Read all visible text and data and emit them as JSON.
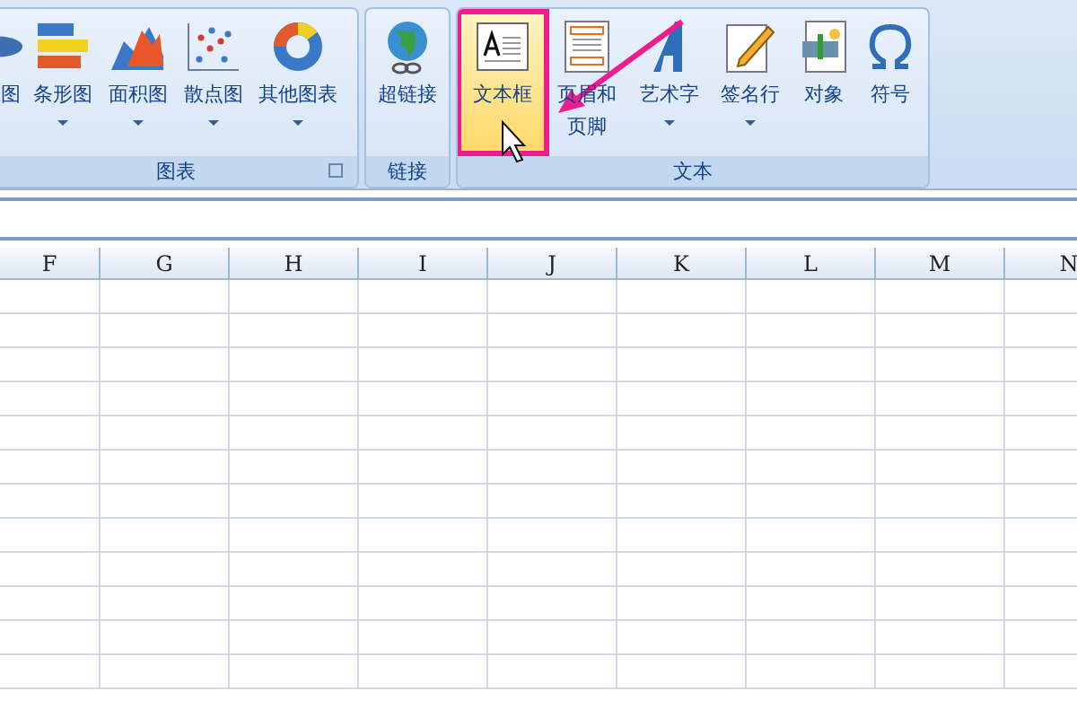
{
  "ribbon": {
    "groups": [
      {
        "label": "图表",
        "launcher": true,
        "buttons": [
          {
            "kind": "pie",
            "lines": [
              "图"
            ],
            "dropdown": false,
            "selected": false
          },
          {
            "kind": "bar",
            "lines": [
              "条形图"
            ],
            "dropdown": true,
            "selected": false
          },
          {
            "kind": "area",
            "lines": [
              "面积图"
            ],
            "dropdown": true,
            "selected": false
          },
          {
            "kind": "scatter",
            "lines": [
              "散点图"
            ],
            "dropdown": true,
            "selected": false
          },
          {
            "kind": "donut",
            "lines": [
              "其他图表"
            ],
            "dropdown": true,
            "selected": false
          }
        ]
      },
      {
        "label": "链接",
        "launcher": false,
        "buttons": [
          {
            "kind": "globe",
            "lines": [
              "超链接"
            ],
            "dropdown": false,
            "selected": false
          }
        ]
      },
      {
        "label": "文本",
        "launcher": false,
        "buttons": [
          {
            "kind": "textbox",
            "lines": [
              "文本框"
            ],
            "dropdown": false,
            "selected": true
          },
          {
            "kind": "header",
            "lines": [
              "页眉和",
              "页脚"
            ],
            "dropdown": false,
            "selected": false
          },
          {
            "kind": "wordart",
            "lines": [
              "艺术字"
            ],
            "dropdown": true,
            "selected": false
          },
          {
            "kind": "signature",
            "lines": [
              "签名行"
            ],
            "dropdown": true,
            "selected": false
          },
          {
            "kind": "object",
            "lines": [
              "对象"
            ],
            "dropdown": false,
            "selected": false
          },
          {
            "kind": "symbol",
            "lines": [
              "符号"
            ],
            "dropdown": false,
            "selected": false
          }
        ]
      }
    ]
  },
  "sheet": {
    "columns": [
      "F",
      "G",
      "H",
      "I",
      "J",
      "K",
      "L",
      "M",
      "N"
    ]
  }
}
